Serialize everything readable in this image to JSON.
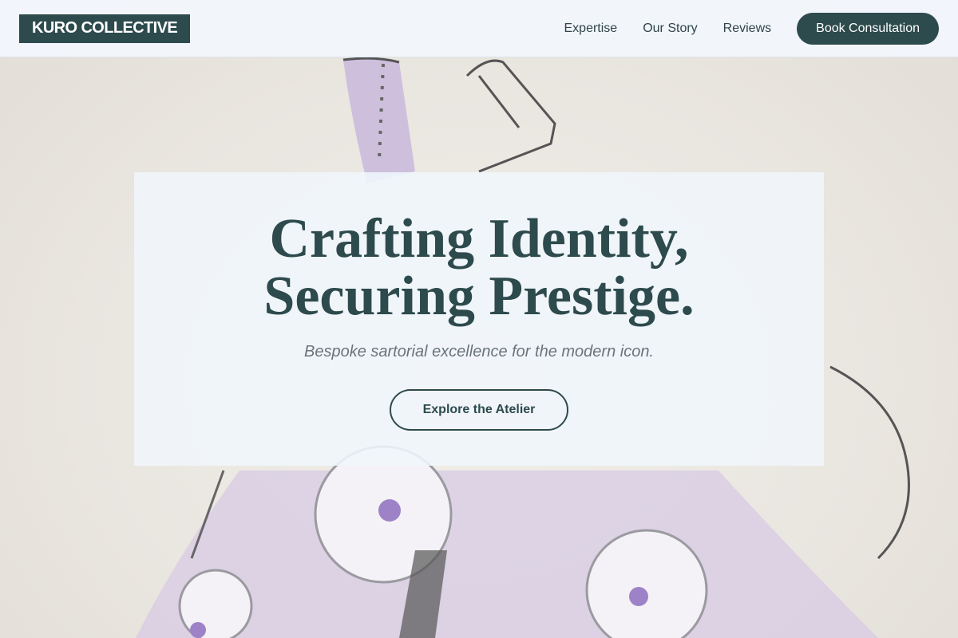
{
  "header": {
    "brand": "KURO COLLECTIVE",
    "nav": [
      {
        "label": "Expertise"
      },
      {
        "label": "Our Story"
      },
      {
        "label": "Reviews"
      }
    ],
    "cta": "Book Consultation"
  },
  "hero": {
    "title_line1": "Crafting Identity,",
    "title_line2": "Securing Prestige.",
    "subtitle": "Bespoke sartorial excellence for the modern icon.",
    "button": "Explore the Atelier"
  },
  "colors": {
    "primary": "#2d4a4d",
    "header_bg": "#f2f7fd",
    "subtitle": "#6b7479",
    "gown_lilac": "#c7b6d9"
  },
  "background": {
    "icon": "watercolor-gown-illustration"
  }
}
